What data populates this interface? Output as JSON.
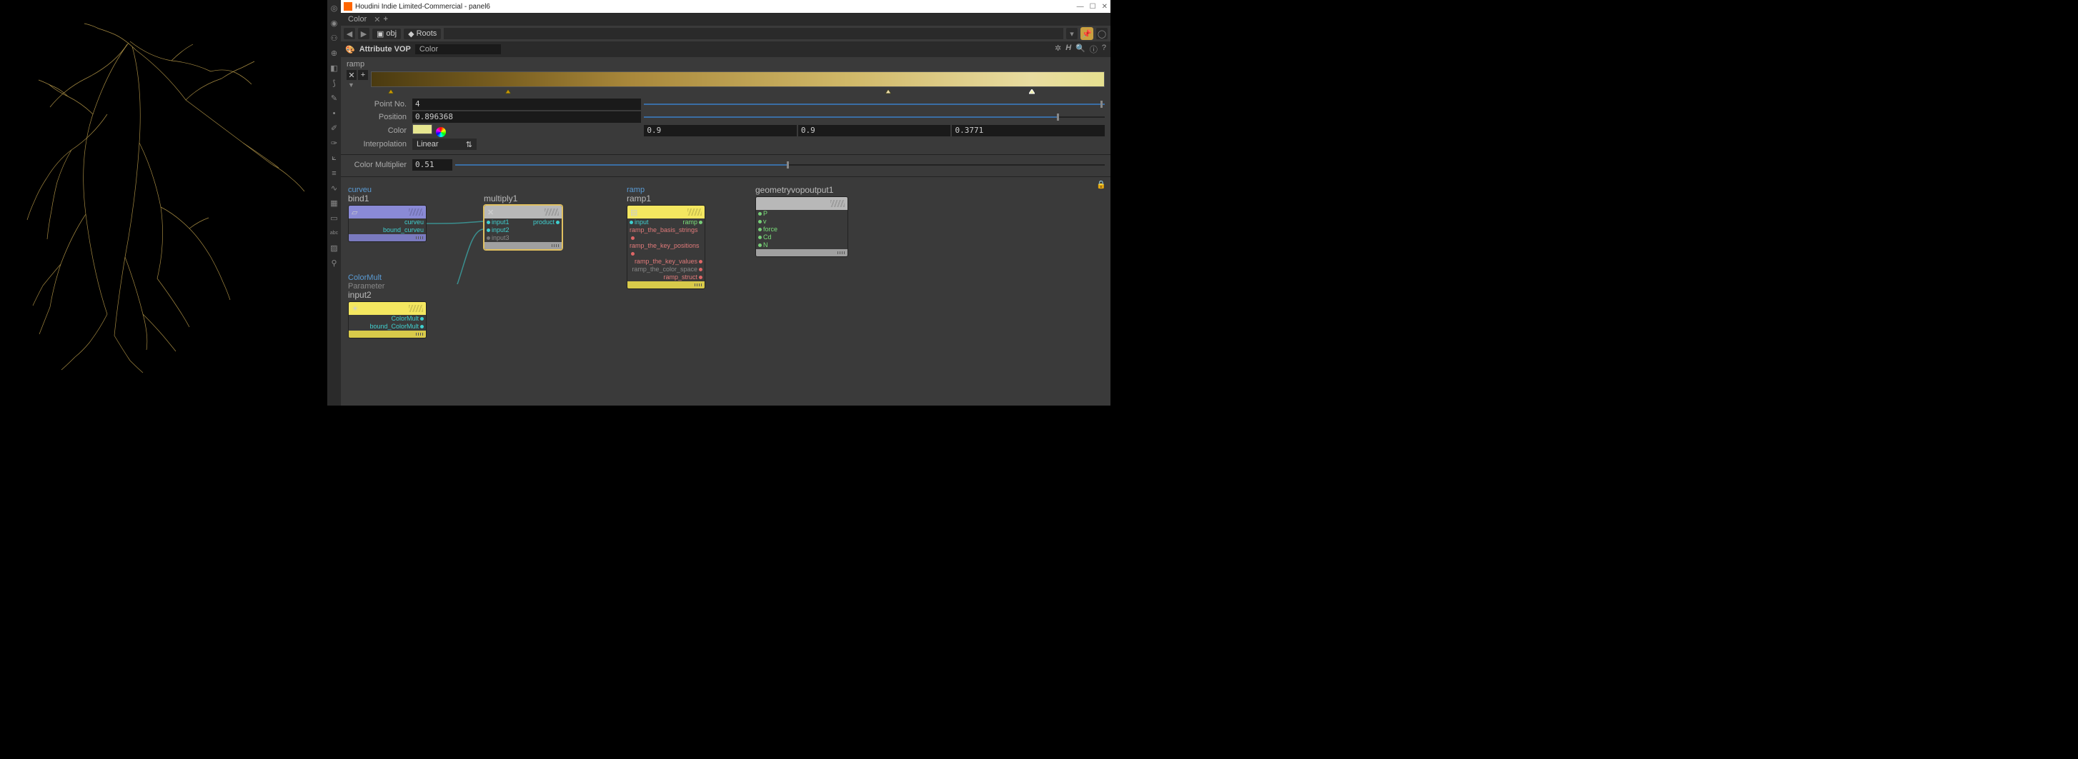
{
  "window": {
    "title": "Houdini Indie Limited-Commercial - panel6"
  },
  "tabs": {
    "active": "Color",
    "add": "+"
  },
  "path": {
    "obj": "obj",
    "roots": "Roots"
  },
  "node_header": {
    "type": "Attribute VOP",
    "name": "Color"
  },
  "ramp": {
    "label": "ramp",
    "point_no_label": "Point No.",
    "point_no": "4",
    "position_label": "Position",
    "position": "0.896368",
    "color_label": "Color",
    "c_r": "0.9",
    "c_g": "0.9",
    "c_b": "0.3771",
    "interp_label": "Interpolation",
    "interp": "Linear"
  },
  "color_mult": {
    "label": "Color Multiplier",
    "value": "0.51"
  },
  "nodes": {
    "bind1": {
      "t1": "curveu",
      "t2": "bind1",
      "out1": "curveu",
      "out2": "bound_curveu"
    },
    "multiply1": {
      "t2": "multiply1",
      "in1": "input1",
      "in2": "input2",
      "in3": "input3",
      "out": "product"
    },
    "ramp1": {
      "t1": "ramp",
      "t2": "ramp1",
      "in": "input",
      "out_ramp": "ramp",
      "o1": "ramp_the_basis_strings",
      "o2": "ramp_the_key_positions",
      "o3": "ramp_the_key_values",
      "o4": "ramp_the_color_space",
      "o5": "ramp_struct"
    },
    "input2": {
      "t1": "ColorMult",
      "tg": "Parameter",
      "t2": "input2",
      "out1": "ColorMult",
      "out2": "bound_ColorMult"
    },
    "geoout": {
      "t2": "geometryvopoutput1",
      "p": "P",
      "v": "v",
      "force": "force",
      "cd": "Cd",
      "n": "N"
    }
  }
}
